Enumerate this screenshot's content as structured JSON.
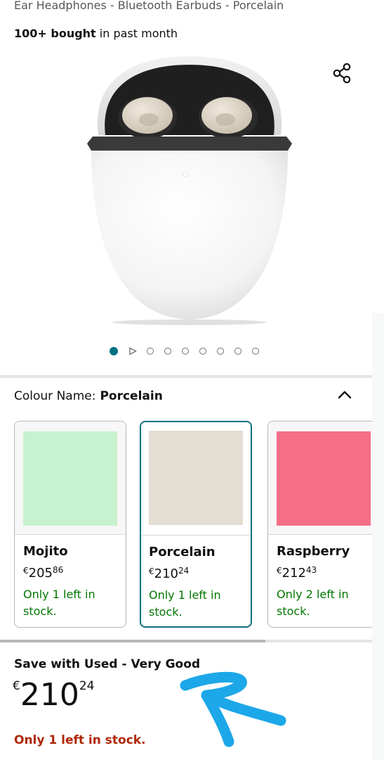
{
  "product": {
    "title_line": "Ear Headphones - Bluetooth Earbuds - Porcelain",
    "bought_bold": "100+ bought",
    "bought_rest": " in past month"
  },
  "icons": {
    "share": "share-icon",
    "collapse": "chevron-up-icon",
    "play": "play-icon"
  },
  "gallery": {
    "dot_count": 9,
    "active_index": 0
  },
  "colour": {
    "label": "Colour Name:",
    "selected": "Porcelain"
  },
  "swatches": [
    {
      "name": "Mojito",
      "currency": "€",
      "whole": "205",
      "cents": "86",
      "stock": "Only 1 left in stock.",
      "color": "#c8f2cf",
      "selected": false
    },
    {
      "name": "Porcelain",
      "currency": "€",
      "whole": "210",
      "cents": "24",
      "stock": "Only 1 left in stock.",
      "color": "#e4ddd2",
      "selected": true
    },
    {
      "name": "Raspberry",
      "currency": "€",
      "whole": "212",
      "cents": "43",
      "stock": "Only 2 left in stock.",
      "color": "#f56f87",
      "selected": false
    }
  ],
  "used_offer": {
    "title": "Save with Used - Very Good",
    "currency": "€",
    "whole": "210",
    "cents": "24",
    "stock": "Only 1 left in stock."
  },
  "colors": {
    "accent_teal": "#007185",
    "stock_green": "#007600",
    "stock_red": "#b12704",
    "annotation_blue": "#1ca7e8"
  }
}
